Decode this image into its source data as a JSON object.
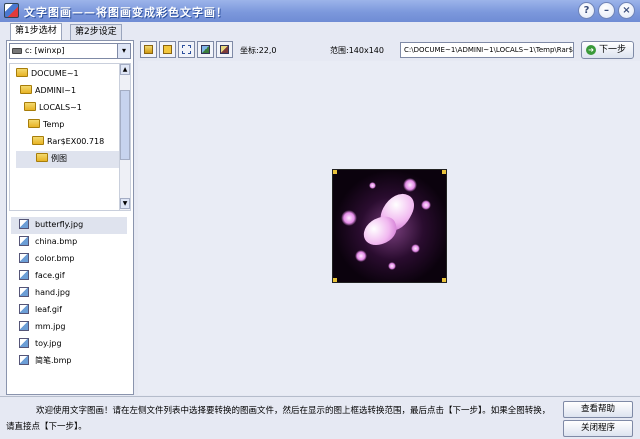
{
  "window": {
    "title": "文字图画——将图画变成彩色文字画！",
    "help_glyph": "?",
    "min_glyph": "–",
    "close_glyph": "×"
  },
  "tabs": [
    {
      "label": "第1步选材",
      "active": true
    },
    {
      "label": "第2步设定",
      "active": false
    }
  ],
  "drive": {
    "label": "c: [winxp]",
    "arrow": "▾"
  },
  "folders": [
    {
      "label": "DOCUME~1",
      "indent": 0,
      "open": true
    },
    {
      "label": "ADMINI~1",
      "indent": 1,
      "open": true
    },
    {
      "label": "LOCALS~1",
      "indent": 2,
      "open": true
    },
    {
      "label": "Temp",
      "indent": 3,
      "open": true
    },
    {
      "label": "Rar$EX00.718",
      "indent": 4,
      "open": true
    },
    {
      "label": "例图",
      "indent": 5,
      "open": true,
      "selected": true
    }
  ],
  "tree_scroll": {
    "up": "▲",
    "down": "▼"
  },
  "files": [
    {
      "name": "butterfly.jpg",
      "selected": true
    },
    {
      "name": "china.bmp"
    },
    {
      "name": "color.bmp"
    },
    {
      "name": "face.gif"
    },
    {
      "name": "hand.jpg"
    },
    {
      "name": "leaf.gif"
    },
    {
      "name": "mm.jpg"
    },
    {
      "name": "toy.jpg"
    },
    {
      "name": "简笔.bmp"
    }
  ],
  "toolbar": {
    "coords": "坐标:22,0",
    "size": "范围:140x140",
    "path": "C:\\DOCUME~1\\ADMINI~1\\LOCALS~1\\Temp\\Rar$EX00.718\\例图",
    "next_label": "下一步",
    "next_glyph": "➜"
  },
  "status": {
    "message": "欢迎使用文字图画！请在左侧文件列表中选择要转换的图画文件，然后在显示的图上框选转换范围，最后点击【下一步】。如果全图转换，请直接点【下一步】。"
  },
  "buttons": {
    "help": "查看帮助",
    "close": "关闭程序"
  }
}
